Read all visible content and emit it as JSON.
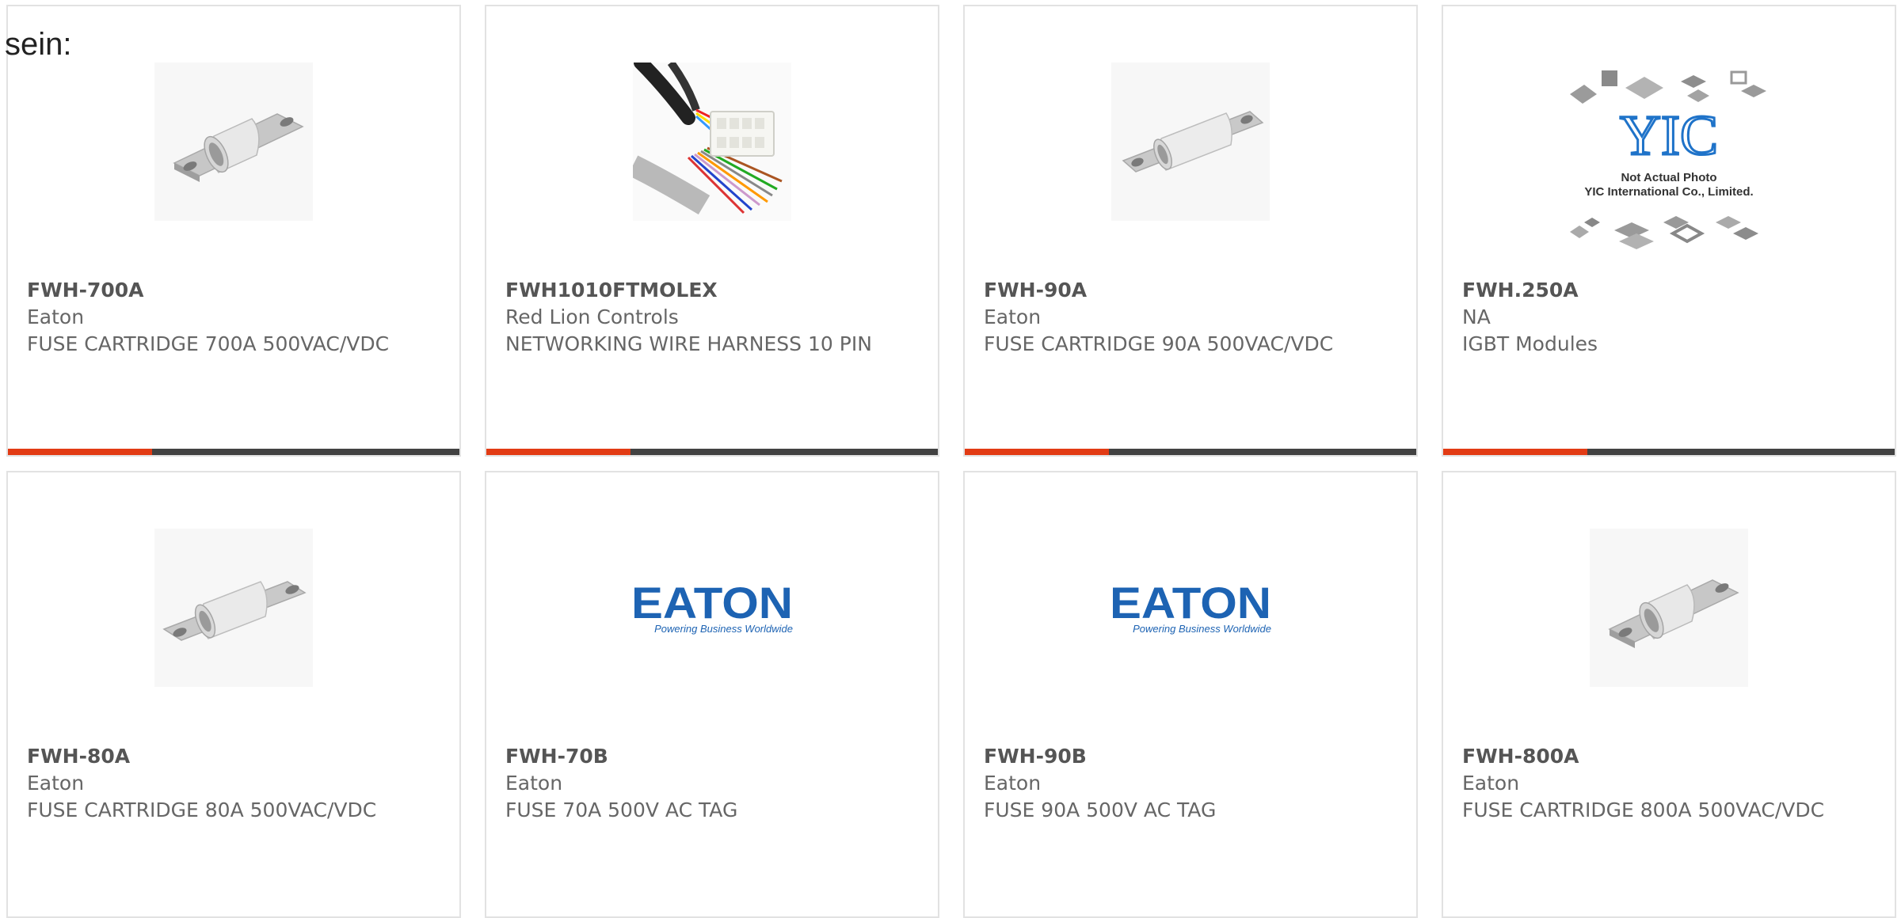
{
  "page": {
    "prefix_text": "sein:"
  },
  "colors": {
    "accent": "#e23b14",
    "bar": "#424242",
    "text": "#666666",
    "border": "#e2e2e2"
  },
  "products": [
    {
      "part_number": "FWH-700A",
      "manufacturer": "Eaton",
      "description": "FUSE CARTRIDGE 700A 500VAC/VDC",
      "image": "fuse-cartridge-image"
    },
    {
      "part_number": "FWH1010FTMOLEX",
      "manufacturer": "Red Lion Controls",
      "description": "NETWORKING WIRE HARNESS 10 PIN",
      "image": "wire-harness-image"
    },
    {
      "part_number": "FWH-90A",
      "manufacturer": "Eaton",
      "description": "FUSE CARTRIDGE 90A 500VAC/VDC",
      "image": "fuse-cartridge-image"
    },
    {
      "part_number": "FWH.250A",
      "manufacturer": "NA",
      "description": "IGBT Modules",
      "image": "yic-placeholder-image",
      "image_text": {
        "logo": "YIC",
        "line1": "Not Actual Photo",
        "line2": "YIC International Co., Limited."
      }
    },
    {
      "part_number": "FWH-80A",
      "manufacturer": "Eaton",
      "description": "FUSE CARTRIDGE 80A 500VAC/VDC",
      "image": "fuse-cartridge-image"
    },
    {
      "part_number": "FWH-70B",
      "manufacturer": "Eaton",
      "description": "FUSE 70A 500V AC TAG",
      "image": "eaton-logo-image",
      "image_text": {
        "logo": "EATON",
        "tagline": "Powering Business Worldwide"
      }
    },
    {
      "part_number": "FWH-90B",
      "manufacturer": "Eaton",
      "description": "FUSE 90A 500V AC TAG",
      "image": "eaton-logo-image",
      "image_text": {
        "logo": "EATON",
        "tagline": "Powering Business Worldwide"
      }
    },
    {
      "part_number": "FWH-800A",
      "manufacturer": "Eaton",
      "description": "FUSE CARTRIDGE 800A 500VAC/VDC",
      "image": "fuse-cartridge-image"
    }
  ]
}
